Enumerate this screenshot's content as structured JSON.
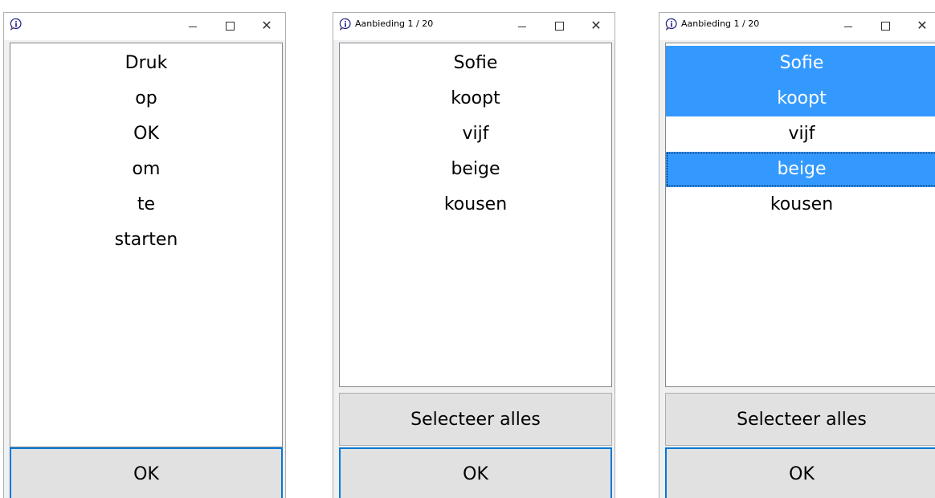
{
  "windows": [
    {
      "title": "",
      "list_items": [
        "Druk",
        "op",
        "OK",
        "om",
        "te",
        "starten"
      ],
      "buttons": {
        "ok": "OK"
      }
    },
    {
      "title": "Aanbieding 1 / 20",
      "list_items": [
        "Sofie",
        "koopt",
        "vijf",
        "beige",
        "kousen"
      ],
      "buttons": {
        "select_all": "Selecteer alles",
        "ok": "OK"
      }
    },
    {
      "title": "Aanbieding 1 / 20",
      "list_items": [
        "Sofie",
        "koopt",
        "vijf",
        "beige",
        "kousen"
      ],
      "selected_items": [
        "Sofie",
        "koopt",
        "beige"
      ],
      "buttons": {
        "select_all": "Selecteer alles",
        "ok": "OK"
      }
    }
  ],
  "colors": {
    "selection": "#3399ff",
    "default_button_border": "#0078d7"
  },
  "icons": {
    "app": "info-bubble-icon",
    "minimize": "minimize-icon",
    "maximize": "maximize-icon",
    "close": "close-icon"
  }
}
